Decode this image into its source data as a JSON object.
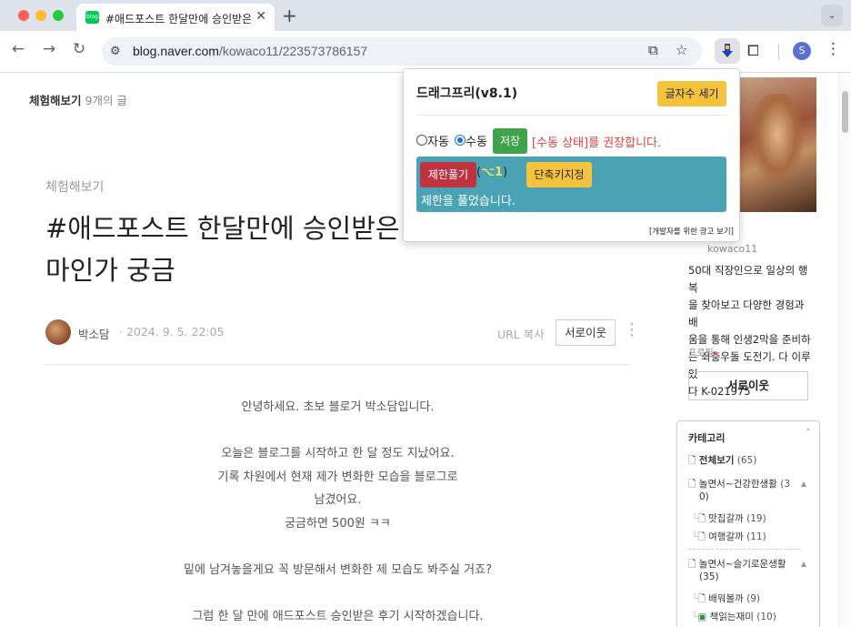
{
  "browser": {
    "tab": {
      "favicon_text": "blog",
      "title": "#애드포스트 한달만에 승인받은 후기",
      "close_glyph": "✕"
    },
    "new_tab_glyph": "+",
    "tab_menu_glyph": "⌄",
    "url_host": "blog.naver.com",
    "url_path": "/kowaco11/223573786157",
    "profile_initial": "S"
  },
  "page": {
    "blog_header": {
      "category": "체험해보기",
      "count": "9개의 글"
    },
    "post": {
      "category": "체험해보기",
      "title_lines": [
        "#애드포스트 한달만에 승인받은",
        "마인가 궁금"
      ],
      "author": "박소담",
      "date": "· 2024. 9. 5. 22:05",
      "url_copy": "URL 복사",
      "neighbor_button": "서로이웃",
      "body_lines": [
        "안녕하세요. 초보 블로거 박소담입니다.",
        "",
        "오늘은 블로그를 시작하고 한 달 정도 지났어요.",
        "기록 차원에서 현재 제가 변화한 모습을 블로그로",
        "남겼어요.",
        "궁금하면 500원 ㅋㅋ",
        "",
        "밑에 남겨놓을게요 꼭 방문해서 변화한 제 모습도 봐주실 거죠?",
        "",
        "그럼 한 달 만에 애드포스트 승인받은 후기 시작하겠습니다."
      ]
    },
    "sidebar": {
      "blog_id": "kowaco11",
      "description_lines": [
        "50대 직장인으로 일상의 행복",
        "을 찾아보고 다양한 경험과 배",
        "움을 통해 인생2막을 준비하",
        "는 좌충우돌 도전기.  다 이루었",
        "다 K-021975"
      ],
      "profile_link": "프로필",
      "profile_link_arrow": "▸",
      "neighbor_button": "서로이웃",
      "category_title": "카테고리",
      "categories": [
        {
          "label": "전체보기",
          "count": "(65)"
        },
        {
          "label": "놀면서~건강한생활",
          "count": "(3"
        },
        {
          "label": "0)",
          "count": ""
        },
        {
          "label": "맛집갈까",
          "count": "(19)"
        },
        {
          "label": "여행갈까",
          "count": "(11)"
        },
        {
          "label": "놀면서~슬기로운생활",
          "count": ""
        },
        {
          "label": "(35)",
          "count": ""
        },
        {
          "label": "배워볼까",
          "count": "(9)"
        },
        {
          "label": "책읽는재미",
          "count": "(10)"
        }
      ]
    }
  },
  "extension_popup": {
    "title": "드래그프리(v8.1)",
    "count_button": "글자수 세기",
    "radio_auto": "자동",
    "radio_manual": "수동",
    "save_button": "저장",
    "recommend_text": "[수동 상태]를 권장합니다.",
    "unlimit_button": "제한풀기",
    "shortcut_open": "(",
    "shortcut_key": "⌥1",
    "shortcut_close": ")",
    "shortcut_button": "단축키지정",
    "status_text": "제한을 풀었습니다.",
    "dev_ad_link": "[개발자를 위한 광고 보기]"
  }
}
